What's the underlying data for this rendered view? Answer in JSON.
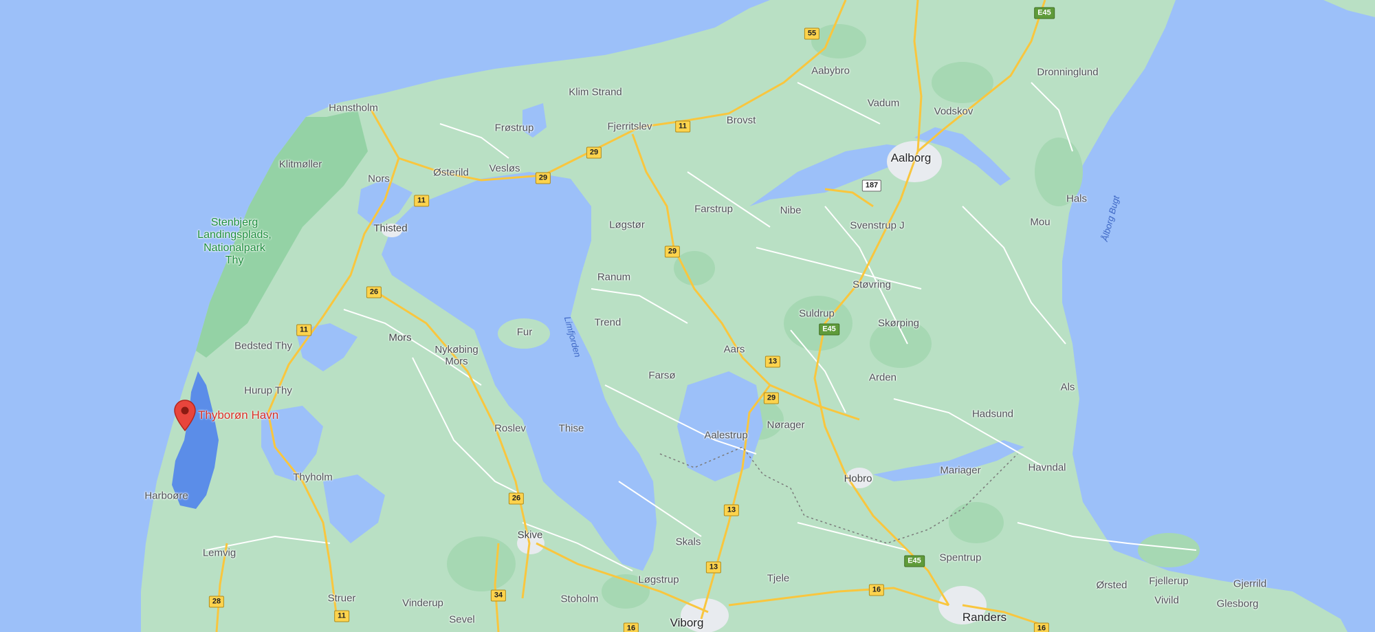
{
  "colors": {
    "water": "#9cc0f9",
    "land": "#b9e0c4",
    "forest": "#94d2a5",
    "urban": "#e8ebef",
    "road_major": "#f9c63e",
    "road_minor": "#ffffff",
    "selected_water": "#5b8de8",
    "pin": "#e8453c"
  },
  "marker": {
    "name": "Thyborøn Havn",
    "icon": "map-pin-icon"
  },
  "places": {
    "aalborg": "Aalborg",
    "randers": "Randers",
    "viborg": "Viborg",
    "hobro": "Hobro",
    "skive": "Skive",
    "thisted": "Thisted",
    "hanstholm": "Hanstholm",
    "klitmoller": "Klitmøller",
    "nors": "Nors",
    "osterild": "Østerild",
    "veslos": "Vesløs",
    "frostrup": "Frøstrup",
    "klim_strand": "Klim Strand",
    "fjerritslev": "Fjerritslev",
    "brovst": "Brovst",
    "aabybro": "Aabybro",
    "vadum": "Vadum",
    "vodskov": "Vodskov",
    "dronninglund": "Dronninglund",
    "hals": "Hals",
    "mou": "Mou",
    "farstrup": "Farstrup",
    "nibe": "Nibe",
    "svenstrup": "Svenstrup J",
    "logstor": "Løgstør",
    "ranum": "Ranum",
    "trend": "Trend",
    "storving": "Støvring",
    "suldrup": "Suldrup",
    "skorping": "Skørping",
    "aars": "Aars",
    "farso": "Farsø",
    "arden": "Arden",
    "als": "Als",
    "hadsund": "Hadsund",
    "aalestrup": "Aalestrup",
    "norager": "Nørager",
    "mariager": "Mariager",
    "havndal": "Havndal",
    "spentrup": "Spentrup",
    "orsted": "Ørsted",
    "fjellerup": "Fjellerup",
    "gjerrild": "Gjerrild",
    "vivild": "Vivild",
    "glesborg": "Glesborg",
    "tjele": "Tjele",
    "skals": "Skals",
    "logstrup": "Løgstrup",
    "stoholm": "Stoholm",
    "vinderup": "Vinderup",
    "sevel": "Sevel",
    "struer": "Struer",
    "lemvig": "Lemvig",
    "harboore": "Harboøre",
    "thyholm": "Thyholm",
    "roslev": "Roslev",
    "thise": "Thise",
    "fur": "Fur",
    "mors": "Mors",
    "nykobing": "Nykøbing\nMors",
    "hurup": "Hurup Thy",
    "bedsted": "Bedsted Thy",
    "stenbjerg": "Stenbjerg\nLandingsplads,\nNationalpark\nThy"
  },
  "water_labels": {
    "limfjorden": "Limfjorden",
    "aalborg_bugt": "Ålborg Bugt"
  },
  "shields": {
    "s55": "55",
    "e45_top": "E45",
    "s11_a": "11",
    "s29_a": "29",
    "s29_b": "29",
    "s11_b": "11",
    "s187": "187",
    "s29_c": "29",
    "s26_a": "26",
    "s11_c": "11",
    "e45_mid": "E45",
    "s13_a": "13",
    "s29_d": "29",
    "s26_b": "26",
    "s13_b": "13",
    "s13_c": "13",
    "e45_bot": "E45",
    "s16_a": "16",
    "s34": "34",
    "s28": "28",
    "s11_d": "11",
    "s16_b": "16",
    "s16_c": "16"
  }
}
